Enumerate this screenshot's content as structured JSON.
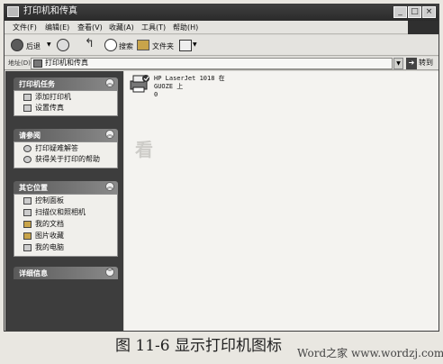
{
  "window": {
    "title": "打印机和传真",
    "controls": [
      "_",
      "□",
      "×"
    ]
  },
  "menu": [
    "文件(F)",
    "编辑(E)",
    "查看(V)",
    "收藏(A)",
    "工具(T)",
    "帮助(H)"
  ],
  "toolbar": {
    "back_label": "后退",
    "search_label": "搜索",
    "folders_label": "文件夹"
  },
  "address": {
    "label": "地址(D)",
    "value": "打印机和传真",
    "go_label": "转到"
  },
  "tasks": {
    "printer_tasks": {
      "title": "打印机任务",
      "items": [
        "添加打印机",
        "设置传真"
      ]
    },
    "see_also": {
      "title": "请参阅",
      "items": [
        "打印疑难解答",
        "获得关于打印的帮助"
      ]
    },
    "other_places": {
      "title": "其它位置",
      "items": [
        "控制面板",
        "扫描仪和照相机",
        "我的文档",
        "图片收藏",
        "我的电脑"
      ]
    },
    "details": {
      "title": "详细信息"
    }
  },
  "printer": {
    "name_line1": "HP LaserJet 1018 在",
    "name_line2": "GUOZE 上",
    "count": "0"
  },
  "caption": "图 11-6    显示打印机图标",
  "site_watermark": "Word之家 www.wordzj.com"
}
